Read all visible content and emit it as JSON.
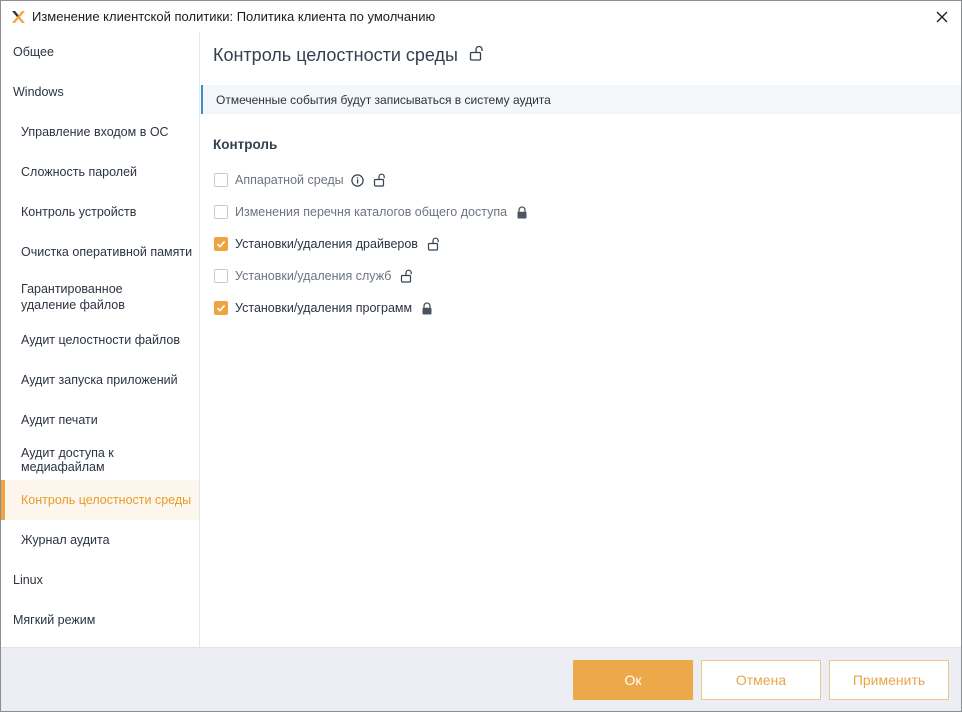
{
  "window": {
    "title": "Изменение клиентской политики: Политика клиента по умолчанию"
  },
  "sidebar": {
    "items": [
      {
        "label": "Общее",
        "level": "top",
        "active": false
      },
      {
        "label": "Windows",
        "level": "top",
        "active": false
      },
      {
        "label": "Управление входом в ОС",
        "level": "sub",
        "active": false
      },
      {
        "label": "Сложность паролей",
        "level": "sub",
        "active": false
      },
      {
        "label": "Контроль устройств",
        "level": "sub",
        "active": false
      },
      {
        "label": "Очистка оперативной памяти",
        "level": "sub",
        "active": false
      },
      {
        "label": "Гарантированное\nудаление файлов",
        "level": "sub",
        "active": false
      },
      {
        "label": "Аудит целостности файлов",
        "level": "sub",
        "active": false
      },
      {
        "label": "Аудит запуска приложений",
        "level": "sub",
        "active": false
      },
      {
        "label": "Аудит печати",
        "level": "sub",
        "active": false
      },
      {
        "label": "Аудит доступа к медиафайлам",
        "level": "sub",
        "active": false
      },
      {
        "label": "Контроль целостности среды",
        "level": "sub",
        "active": true
      },
      {
        "label": "Журнал аудита",
        "level": "sub",
        "active": false
      },
      {
        "label": "Linux",
        "level": "top",
        "active": false
      },
      {
        "label": "Мягкий режим",
        "level": "top",
        "active": false
      }
    ]
  },
  "main": {
    "title": "Контроль целостности среды",
    "title_icon": "lock-open-icon",
    "info": "Отмеченные события будут записываться в систему аудита",
    "section_title": "Контроль",
    "options": [
      {
        "label": "Аппаратной среды",
        "checked": false,
        "disabled": true,
        "icons": [
          "info-icon",
          "lock-open-icon"
        ]
      },
      {
        "label": "Изменения перечня каталогов общего доступа",
        "checked": false,
        "disabled": true,
        "icons": [
          "lock-closed-icon"
        ]
      },
      {
        "label": "Установки/удаления драйверов",
        "checked": true,
        "disabled": false,
        "icons": [
          "lock-open-icon"
        ]
      },
      {
        "label": "Установки/удаления служб",
        "checked": false,
        "disabled": true,
        "icons": [
          "lock-open-icon"
        ]
      },
      {
        "label": "Установки/удаления программ",
        "checked": true,
        "disabled": false,
        "icons": [
          "lock-closed-icon"
        ]
      }
    ]
  },
  "footer": {
    "ok_label": "Ок",
    "cancel_label": "Отмена",
    "apply_label": "Применить"
  },
  "colors": {
    "accent": "#f0a440",
    "info_border": "#3a8fc4",
    "footer_bg": "#eceef4"
  }
}
